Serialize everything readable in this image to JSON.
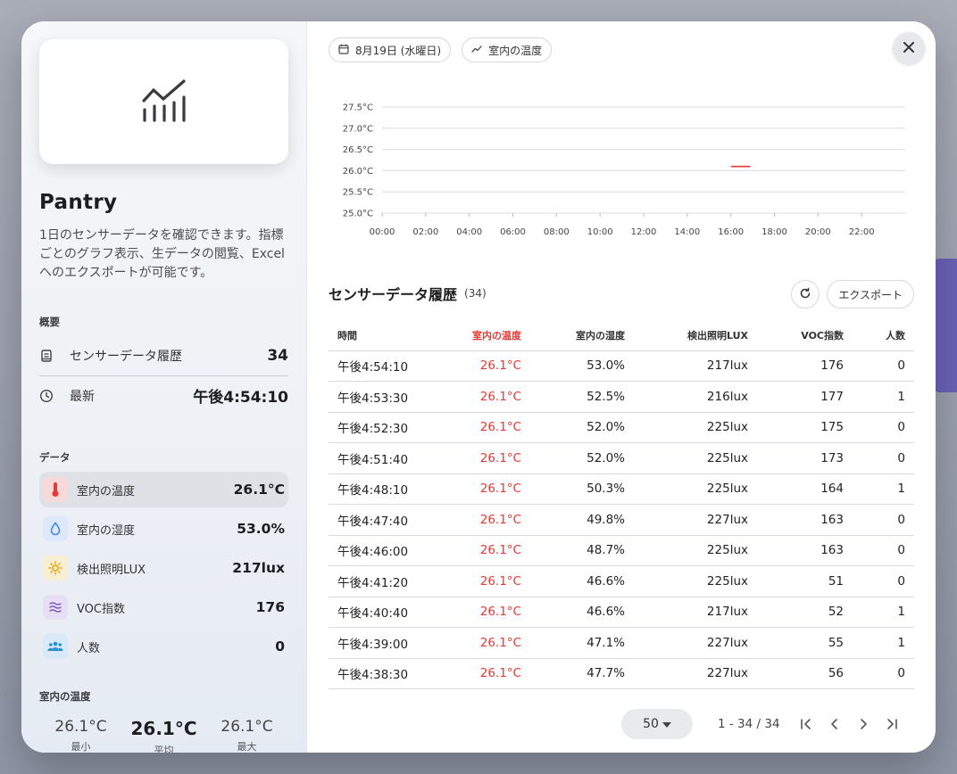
{
  "sidebar": {
    "title": "Pantry",
    "description": "1日のセンサーデータを確認できます。指標ごとのグラフ表示、生データの閲覧、Excelへのエクスポートが可能です。",
    "overview_label": "概要",
    "overview": [
      {
        "label": "センサーデータ履歴",
        "value": "34",
        "icon": "clipboard-icon"
      },
      {
        "label": "最新",
        "value": "午後4:54:10",
        "icon": "clock-icon"
      }
    ],
    "data_label": "データ",
    "metrics": [
      {
        "label": "室内の温度",
        "value": "26.1°C",
        "icon": "thermometer-icon",
        "color": "#e53935",
        "bg": "#f7d9da",
        "active": true
      },
      {
        "label": "室内の湿度",
        "value": "53.0%",
        "icon": "droplet-icon",
        "color": "#3b82f6",
        "bg": "#dde8fa",
        "active": false
      },
      {
        "label": "検出照明LUX",
        "value": "217lux",
        "icon": "sun-icon",
        "color": "#e6a100",
        "bg": "#f8efd3",
        "active": false
      },
      {
        "label": "VOC指数",
        "value": "176",
        "icon": "waves-icon",
        "color": "#7c5cc4",
        "bg": "#e6def5",
        "active": false
      },
      {
        "label": "人数",
        "value": "0",
        "icon": "people-icon",
        "color": "#2b8fd6",
        "bg": "#d8e9f7",
        "active": false
      }
    ],
    "stats_label": "室内の温度",
    "stats": [
      {
        "value": "26.1°C",
        "label": "最小"
      },
      {
        "value": "26.1°C",
        "label": "平均"
      },
      {
        "value": "26.1°C",
        "label": "最大"
      }
    ]
  },
  "header": {
    "date_chip": "8月19日 (水曜日)",
    "metric_chip": "室内の温度"
  },
  "chart_data": {
    "type": "line",
    "x_ticks": [
      "00:00",
      "02:00",
      "04:00",
      "06:00",
      "08:00",
      "10:00",
      "12:00",
      "14:00",
      "16:00",
      "18:00",
      "20:00",
      "22:00"
    ],
    "y_ticks": [
      "25.0°C",
      "25.5°C",
      "26.0°C",
      "26.5°C",
      "27.0°C",
      "27.5°C"
    ],
    "ylim": [
      25.0,
      27.5
    ],
    "xlim_hours": [
      0,
      24
    ],
    "series": [
      {
        "color": "#e53935",
        "points": [
          {
            "x": "16:00",
            "y": 26.1
          },
          {
            "x": "16:54",
            "y": 26.1
          }
        ]
      }
    ],
    "grid": true
  },
  "table": {
    "title": "センサーデータ履歴",
    "count": "(34)",
    "export_label": "エクスポート",
    "columns": [
      "時間",
      "室内の温度",
      "室内の湿度",
      "検出照明LUX",
      "VOC指数",
      "人数"
    ],
    "rows": [
      [
        "午後4:54:10",
        "26.1°C",
        "53.0%",
        "217lux",
        "176",
        "0"
      ],
      [
        "午後4:53:30",
        "26.1°C",
        "52.5%",
        "216lux",
        "177",
        "1"
      ],
      [
        "午後4:52:30",
        "26.1°C",
        "52.0%",
        "225lux",
        "175",
        "0"
      ],
      [
        "午後4:51:40",
        "26.1°C",
        "52.0%",
        "225lux",
        "173",
        "0"
      ],
      [
        "午後4:48:10",
        "26.1°C",
        "50.3%",
        "225lux",
        "164",
        "1"
      ],
      [
        "午後4:47:40",
        "26.1°C",
        "49.8%",
        "227lux",
        "163",
        "0"
      ],
      [
        "午後4:46:00",
        "26.1°C",
        "48.7%",
        "225lux",
        "163",
        "0"
      ],
      [
        "午後4:41:20",
        "26.1°C",
        "46.6%",
        "225lux",
        "51",
        "0"
      ],
      [
        "午後4:40:40",
        "26.1°C",
        "46.6%",
        "217lux",
        "52",
        "1"
      ],
      [
        "午後4:39:00",
        "26.1°C",
        "47.1%",
        "227lux",
        "55",
        "1"
      ],
      [
        "午後4:38:30",
        "26.1°C",
        "47.7%",
        "227lux",
        "56",
        "0"
      ]
    ]
  },
  "pagination": {
    "per_page": "50",
    "range": "1 - 34 / 34"
  }
}
